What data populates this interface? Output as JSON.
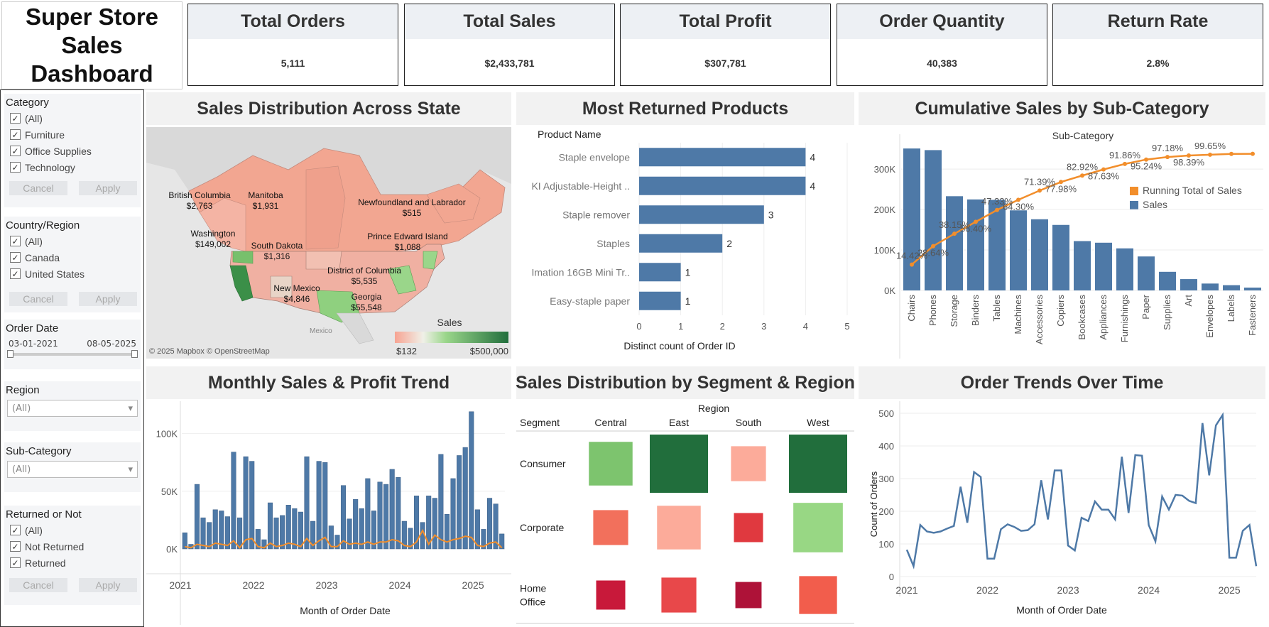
{
  "header": {
    "title_line1": "Super Store",
    "title_line2": "Sales Dashboard"
  },
  "kpis": [
    {
      "label": "Total Orders",
      "value": "5,111"
    },
    {
      "label": "Total Sales",
      "value": "$2,433,781"
    },
    {
      "label": "Total Profit",
      "value": "$307,781"
    },
    {
      "label": "Order Quantity",
      "value": "40,383"
    },
    {
      "label": "Return Rate",
      "value": "2.8%"
    }
  ],
  "filters": {
    "category": {
      "title": "Category",
      "options": [
        "(All)",
        "Furniture",
        "Office Supplies",
        "Technology"
      ]
    },
    "country": {
      "title": "Country/Region",
      "options": [
        "(All)",
        "Canada",
        "United States"
      ]
    },
    "order_date": {
      "title": "Order Date",
      "start": "03-01-2021",
      "end": "08-05-2025"
    },
    "region": {
      "title": "Region",
      "value": "(All)"
    },
    "subcategory": {
      "title": "Sub-Category",
      "value": "(All)"
    },
    "returned": {
      "title": "Returned or Not",
      "options": [
        "(All)",
        "Not Returned",
        "Returned"
      ]
    },
    "cancel_label": "Cancel",
    "apply_label": "Apply",
    "check_glyph": "✓",
    "dropdown_glyph": "▾"
  },
  "map": {
    "title": "Sales Distribution Across State",
    "labels": [
      {
        "name": "British Columbia",
        "value": "$2,763"
      },
      {
        "name": "Manitoba",
        "value": "$1,931"
      },
      {
        "name": "Newfoundland and Labrador",
        "value": "$515"
      },
      {
        "name": "Washington",
        "value": "$149,002"
      },
      {
        "name": "South Dakota",
        "value": "$1,316"
      },
      {
        "name": "Prince Edward Island",
        "value": "$1,088"
      },
      {
        "name": "District of Columbia",
        "value": "$5,535"
      },
      {
        "name": "New Mexico",
        "value": "$4,846"
      },
      {
        "name": "Georgia",
        "value": "$55,548"
      }
    ],
    "country_label": "Mexico",
    "legend_title": "Sales",
    "legend_min": "$132",
    "legend_max": "$500,000",
    "attribution": "© 2025 Mapbox © OpenStreetMap"
  },
  "returned_products": {
    "title": "Most Returned Products",
    "column_header": "Product Name",
    "axis_label": "Distinct count of Order ID",
    "color": "#4e79a7"
  },
  "cumulative": {
    "title": "Cumulative Sales by Sub-Category",
    "header": "Sub-Category",
    "legend": [
      "Running Total of Sales",
      "Sales"
    ],
    "bar_color": "#4e79a7",
    "line_color": "#f28e2b"
  },
  "monthly": {
    "title": "Monthly Sales & Profit Trend",
    "xlabel": "Month of Order Date"
  },
  "segment": {
    "title": "Sales Distribution by Segment & Region",
    "region_header": "Region",
    "segment_header": "Segment"
  },
  "orders": {
    "title": "Order Trends Over Time",
    "xlabel": "Month of Order Date",
    "ylabel": "Count of Orders"
  },
  "chart_data": [
    {
      "id": "returned",
      "type": "bar",
      "orientation": "horizontal",
      "categories": [
        "Staple envelope",
        "KI Adjustable-Height ..",
        "Staple remover",
        "Staples",
        "Imation 16GB Mini Tr..",
        "Easy-staple paper"
      ],
      "values": [
        4,
        4,
        3,
        2,
        1,
        1
      ],
      "xlabel": "Distinct count of Order ID",
      "ylabel": "Product Name",
      "xlim": [
        0,
        5
      ],
      "xticks": [
        0,
        1,
        2,
        3,
        4,
        5
      ]
    },
    {
      "id": "pareto",
      "type": "bar",
      "categories": [
        "Chairs",
        "Phones",
        "Storage",
        "Binders",
        "Tables",
        "Machines",
        "Accessories",
        "Copiers",
        "Bookcases",
        "Appliances",
        "Furnishings",
        "Paper",
        "Supplies",
        "Art",
        "Envelopes",
        "Labels",
        "Fasteners"
      ],
      "series": [
        {
          "name": "Sales",
          "values": [
            351000,
            347000,
            233000,
            225000,
            224000,
            198000,
            176000,
            162000,
            122000,
            118000,
            104000,
            84000,
            46000,
            28000,
            17000,
            13000,
            7000
          ]
        },
        {
          "name": "Running Total of Sales",
          "values": [
            14.42,
            28.64,
            38.15,
            56.4,
            47.33,
            64.3,
            71.39,
            77.98,
            82.92,
            87.63,
            91.86,
            95.24,
            97.18,
            98.39,
            99.0,
            99.6,
            99.65
          ]
        }
      ],
      "ylim": [
        0,
        360000
      ],
      "yticks": [
        "0K",
        "100K",
        "200K",
        "300K"
      ],
      "pct_labels": [
        "14.42%",
        "28.64%",
        "38.15%",
        "56.40%",
        "47.33%",
        "64.30%",
        "71.39%",
        "77.98%",
        "82.92%",
        "87.63%",
        "91.86%",
        "95.24%",
        "97.18%",
        "98.39%",
        "99.65%"
      ]
    },
    {
      "id": "monthly",
      "type": "bar",
      "x_start": "2021-01",
      "xlabel": "Month of Order Date",
      "xticks": [
        "2021",
        "2022",
        "2023",
        "2024",
        "2025"
      ],
      "yticks": [
        "0K",
        "50K",
        "100K"
      ],
      "ylim": [
        0,
        125000
      ],
      "series": [
        {
          "name": "Sales",
          "values": [
            14000,
            4000,
            56000,
            27000,
            23000,
            34000,
            33000,
            28000,
            84000,
            27000,
            80000,
            76000,
            17000,
            8000,
            40000,
            27000,
            29000,
            38000,
            35000,
            32000,
            80000,
            24000,
            76000,
            75000,
            20000,
            12000,
            55000,
            26000,
            43000,
            35000,
            61000,
            33000,
            58000,
            56000,
            69000,
            62000,
            24000,
            18000,
            46000,
            23000,
            46000,
            44000,
            82000,
            30000,
            61000,
            81000,
            88000,
            119000,
            34000,
            17000,
            44000,
            39000,
            13000
          ]
        },
        {
          "name": "Profit",
          "values": [
            2000,
            1000,
            4000,
            3000,
            2000,
            5000,
            4000,
            3000,
            7000,
            1000,
            8000,
            9000,
            2000,
            1000,
            5000,
            2000,
            3000,
            5000,
            4000,
            2000,
            9000,
            3000,
            7000,
            10000,
            2000,
            2000,
            7000,
            4000,
            5000,
            4000,
            6000,
            4000,
            6000,
            6000,
            8000,
            7000,
            3000,
            2000,
            6000,
            16000,
            4000,
            12000,
            8000,
            6000,
            8000,
            9000,
            11000,
            10000,
            3000,
            2000,
            5000,
            6000,
            1000
          ]
        }
      ]
    },
    {
      "id": "segment",
      "type": "heatmap",
      "rows": [
        "Consumer",
        "Corporate",
        "Home Office"
      ],
      "cols": [
        "Central",
        "East",
        "South",
        "West"
      ],
      "colors": [
        [
          "#7dc46e",
          "#216e3c",
          "#fcab9a",
          "#216e3c"
        ],
        [
          "#f2705c",
          "#fcab9a",
          "#e0393f",
          "#98d784"
        ],
        [
          "#c8193a",
          "#e8484a",
          "#ae1238",
          "#f25d4c"
        ]
      ],
      "sizes": [
        [
          0.75,
          1.0,
          0.6,
          1.0
        ],
        [
          0.6,
          0.75,
          0.5,
          0.85
        ],
        [
          0.5,
          0.6,
          0.45,
          0.65
        ]
      ]
    },
    {
      "id": "orders",
      "type": "line",
      "x_start": "2021-01",
      "xlabel": "Month of Order Date",
      "ylabel": "Count of Orders",
      "ylim": [
        0,
        500
      ],
      "yticks": [
        0,
        100,
        200,
        300,
        400,
        500
      ],
      "xticks": [
        "2021",
        "2022",
        "2023",
        "2024",
        "2025"
      ],
      "values": [
        82,
        32,
        158,
        138,
        134,
        138,
        147,
        155,
        275,
        165,
        320,
        305,
        55,
        55,
        145,
        160,
        152,
        140,
        142,
        160,
        295,
        175,
        325,
        325,
        95,
        80,
        180,
        170,
        230,
        205,
        205,
        175,
        367,
        195,
        372,
        370,
        158,
        108,
        245,
        205,
        250,
        248,
        232,
        225,
        470,
        310,
        463,
        495,
        58,
        58,
        140,
        158,
        32
      ]
    }
  ]
}
